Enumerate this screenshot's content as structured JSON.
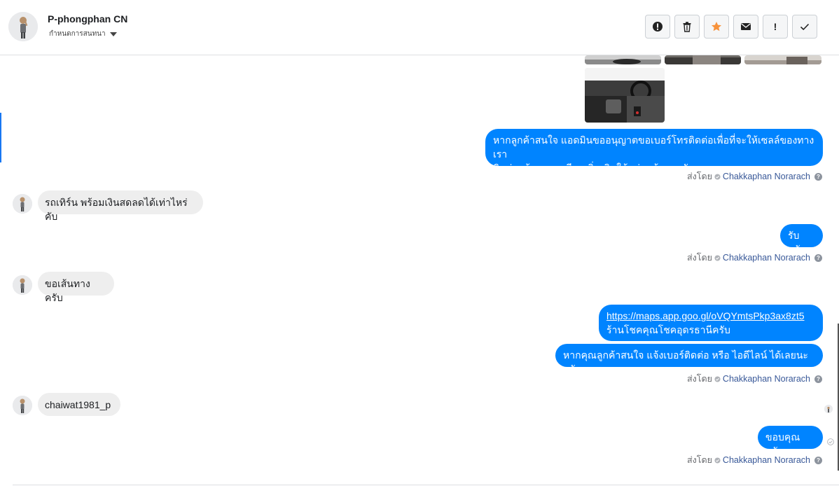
{
  "header": {
    "name": "P-phongphan CN",
    "assign_label": "กำหนดการสนทนา",
    "toolbar_icons": [
      "report-icon",
      "trash-icon",
      "star-icon",
      "mail-icon",
      "exclamation-icon",
      "check-icon"
    ]
  },
  "colors": {
    "outgoing_bubble": "#0084ff",
    "incoming_bubble": "#eeeeee",
    "star": "#f7923b",
    "agent_link": "#385898"
  },
  "sent_by_label": "ส่งโดย",
  "agent_name": "Chakkaphan Norarach",
  "messages": {
    "out_1": "หากลูกค้าสนใจ แอดมินขออนุญาตขอเบอร์โทรติดต่อเพื่อที่จะให้เซลล์ของทางเรา",
    "out_1b": "ติดต่อแจ้งรายละเอียดเพิ่มเติมให้แก่ลูกค้านะครับ",
    "in_1": "รถเทิร์น พร้อมเงินสดลดได้เท่าไหร่คับ",
    "out_2": "รับครับ",
    "in_2": "ขอเส้นทางครับ",
    "out_3_link": "https://maps.app.goo.gl/oVQYmtsPkp3ax8zt5",
    "out_3_text": "ร้านโชคคุณโชคอุดรธานีครับ",
    "out_4": "หากคุณลูกค้าสนใจ แจ้งเบอร์ติดต่อ หรือ ไอดีไลน์ ได้เลยนะครับ",
    "in_3": "chaiwat1981_p",
    "out_5": "ขอบคุณครับ"
  }
}
